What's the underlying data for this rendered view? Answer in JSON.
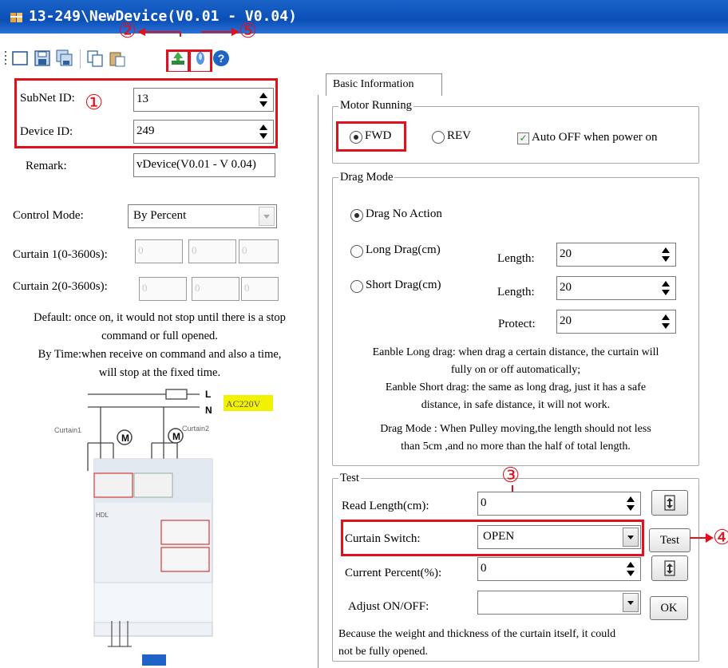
{
  "window": {
    "title": "13-249\\NewDevice(V0.01 - V0.04)"
  },
  "toolbar": {
    "icons": [
      "new-icon",
      "save-icon",
      "save-all-icon",
      "copy-icon",
      "paste-icon",
      "upload-icon",
      "download-icon",
      "help-icon"
    ]
  },
  "callouts": {
    "one": "①",
    "two": "②",
    "three": "③",
    "four": "④",
    "five": "⑤"
  },
  "left": {
    "subnet_label": "SubNet ID:",
    "subnet_value": "13",
    "device_label": "Device ID:",
    "device_value": "249",
    "remark_label": "Remark:",
    "remark_value": "vDevice(V0.01 - V 0.04)",
    "control_mode_label": "Control Mode:",
    "control_mode_value": "By Percent",
    "curtain1_label": "Curtain 1(0-3600s):",
    "curtain1_values": [
      "0",
      "0",
      "0"
    ],
    "curtain2_label": "Curtain 2(0-3600s):",
    "curtain2_values": [
      "0",
      "0",
      "0"
    ],
    "note_line1": "Default: once on, it would not stop until there is a stop",
    "note_line2": "command or full opened.",
    "note_line3": "By Time:when receive on command and also a time,",
    "note_line4": "will stop at the fixed time.",
    "diagram": {
      "L": "L",
      "N": "N",
      "ac": "AC220V",
      "curtain1": "Curtain1",
      "curtain2": "Curtain2",
      "motor": "M",
      "brand": "HDL"
    }
  },
  "tabs": [
    "Basic Information"
  ],
  "motor": {
    "title": "Motor Running",
    "fwd": "FWD",
    "rev": "REV",
    "auto_off": "Auto OFF when power on",
    "selected": "FWD",
    "auto_off_checked": true
  },
  "drag": {
    "title": "Drag Mode",
    "no_action": "Drag No Action",
    "long": "Long Drag(cm)",
    "short": "Short Drag(cm)",
    "length_label": "Length:",
    "long_length": "20",
    "short_length": "20",
    "protect_label": "Protect:",
    "protect_value": "20",
    "note1": "Eanble Long drag: when drag a certain distance, the curtain will",
    "note2": "fully on or off automatically;",
    "note3": "Eanble Short drag: the same as long drag, just it has a safe",
    "note4": "distance, in safe distance, it will not work.",
    "note5": "Drag Mode : When Pulley moving,the length should not less",
    "note6": "than  5cm ,and no more than the half of total length."
  },
  "test": {
    "title": "Test",
    "read_length_label": "Read Length(cm):",
    "read_length_value": "0",
    "switch_label": "Curtain Switch:",
    "switch_value": "OPEN",
    "test_button": "Test",
    "percent_label": "Current Percent(%):",
    "percent_value": "0",
    "adjust_label": "Adjust ON/OFF:",
    "adjust_value": "",
    "ok_button": "OK",
    "note1": "Because the weight and thickness of the curtain itself, it could",
    "note2": "not be fully opened."
  },
  "colors": {
    "titlebar": "#0b4fb6",
    "annotation_red": "#e0101d",
    "ac_highlight": "#f2f200"
  }
}
